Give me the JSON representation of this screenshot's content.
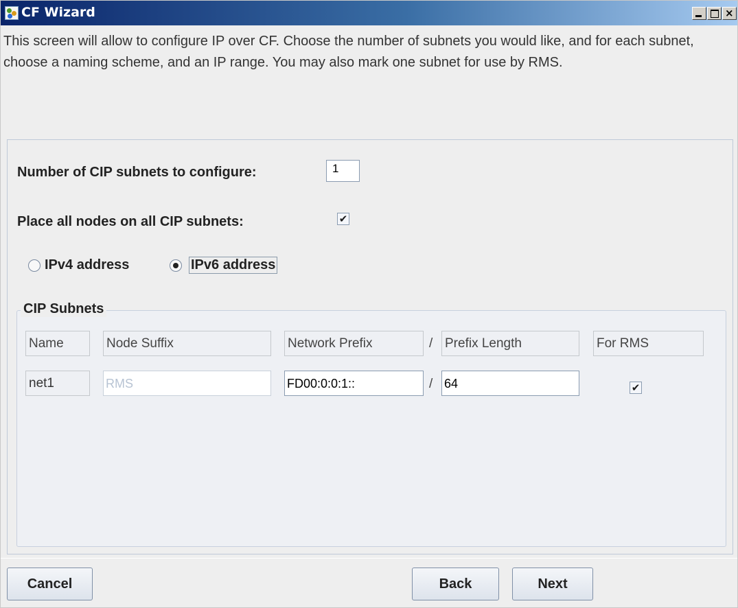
{
  "window": {
    "title": "CF Wizard",
    "controls": {
      "minimize": "minimize",
      "maximize": "maximize",
      "close": "×"
    }
  },
  "intro_text": "This screen will allow to configure IP over CF.  Choose the number of subnets you would like, and for each subnet, choose a naming scheme, and an IP range.  You may also mark one subnet for use by RMS.",
  "form": {
    "subnet_count_label": "Number of CIP subnets to configure:",
    "subnet_count_value": "1",
    "place_all_nodes_label": "Place all nodes on all CIP subnets:",
    "place_all_nodes_checked": true,
    "address_type": {
      "options": [
        "IPv4 address",
        "IPv6 address"
      ],
      "selected": "IPv6 address"
    }
  },
  "cip_subnets": {
    "title": "CIP Subnets",
    "columns": {
      "name": "Name",
      "node_suffix": "Node Suffix",
      "network_prefix": "Network Prefix",
      "separator": "/",
      "prefix_length": "Prefix Length",
      "for_rms": "For RMS"
    },
    "rows": [
      {
        "name": "net1",
        "node_suffix": "RMS",
        "network_prefix": "FD00:0:0:1::",
        "separator": "/",
        "prefix_length": "64",
        "for_rms": true
      }
    ]
  },
  "buttons": {
    "cancel": "Cancel",
    "back": "Back",
    "next": "Next"
  },
  "glyphs": {
    "check": "✔"
  },
  "colors": {
    "titlebar_start": "#0a246a",
    "titlebar_end": "#a6caf0",
    "panel_bg": "#eeeeee"
  }
}
